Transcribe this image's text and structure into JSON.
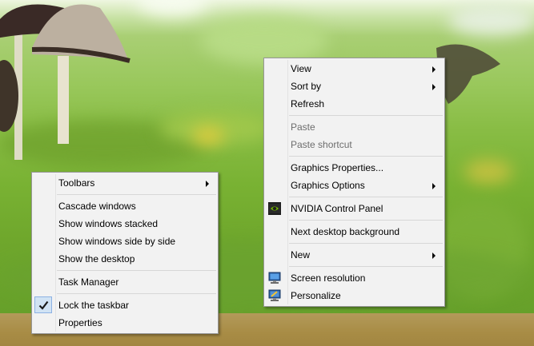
{
  "taskbar_menu": {
    "items": [
      {
        "label": "Toolbars",
        "submenu": true
      },
      {
        "label": "Cascade windows"
      },
      {
        "label": "Show windows stacked"
      },
      {
        "label": "Show windows side by side"
      },
      {
        "label": "Show the desktop"
      },
      {
        "label": "Task Manager"
      },
      {
        "label": "Lock the taskbar",
        "checked": true
      },
      {
        "label": "Properties"
      }
    ]
  },
  "desktop_menu": {
    "items": [
      {
        "label": "View",
        "submenu": true
      },
      {
        "label": "Sort by",
        "submenu": true
      },
      {
        "label": "Refresh"
      },
      {
        "label": "Paste",
        "disabled": true
      },
      {
        "label": "Paste shortcut",
        "disabled": true
      },
      {
        "label": "Graphics Properties..."
      },
      {
        "label": "Graphics Options",
        "submenu": true
      },
      {
        "label": "NVIDIA Control Panel",
        "icon": "nvidia-icon"
      },
      {
        "label": "Next desktop background"
      },
      {
        "label": "New",
        "submenu": true
      },
      {
        "label": "Screen resolution",
        "icon": "monitor-icon"
      },
      {
        "label": "Personalize",
        "icon": "personalize-icon"
      }
    ]
  },
  "colors": {
    "menu_bg": "#f2f2f2",
    "menu_border": "#979797",
    "disabled_text": "#6d6d6d",
    "check_highlight": "#d1e3f4"
  }
}
